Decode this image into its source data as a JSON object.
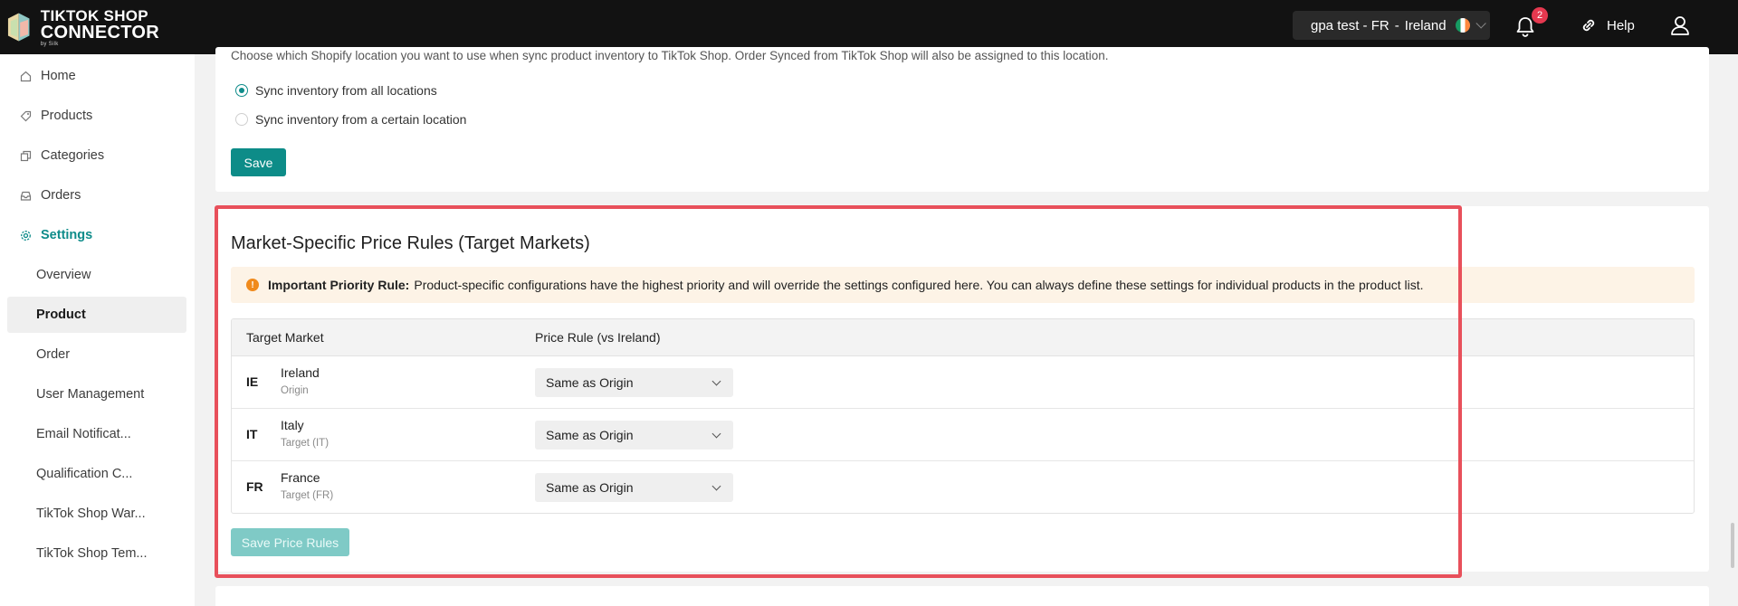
{
  "app": {
    "logo_line1": "TIKTOK SHOP",
    "logo_line2": "CONNECTOR",
    "logo_by": "by Silk"
  },
  "header": {
    "shop_name": "gpa test - FR",
    "shop_separator": "-",
    "shop_region": "Ireland",
    "notification_count": "2",
    "help_label": "Help"
  },
  "sidebar": {
    "items": [
      {
        "label": "Home",
        "icon": "home-icon"
      },
      {
        "label": "Products",
        "icon": "tag-icon"
      },
      {
        "label": "Categories",
        "icon": "copy-icon"
      },
      {
        "label": "Orders",
        "icon": "inbox-icon"
      },
      {
        "label": "Settings",
        "icon": "gear-icon"
      }
    ],
    "settings_sub": [
      {
        "label": "Overview"
      },
      {
        "label": "Product"
      },
      {
        "label": "Order"
      },
      {
        "label": "User Management"
      },
      {
        "label": "Email Notificat..."
      },
      {
        "label": "Qualification C..."
      },
      {
        "label": "TikTok Shop War..."
      },
      {
        "label": "TikTok Shop Tem..."
      }
    ]
  },
  "location_card": {
    "description": "Choose which Shopify location you want to use when sync product inventory to TikTok Shop. Order Synced from TikTok Shop will also be assigned to this location.",
    "options": [
      {
        "label": "Sync inventory from all locations",
        "selected": true
      },
      {
        "label": "Sync inventory from a certain location",
        "selected": false
      }
    ],
    "save_label": "Save"
  },
  "price_rules": {
    "title": "Market-Specific Price Rules (Target Markets)",
    "alert_strong": "Important Priority Rule:",
    "alert_text": "Product-specific configurations have the highest priority and will override the settings configured here. You can always define these settings for individual products in the product list.",
    "columns": [
      "Target Market",
      "Price Rule (vs Ireland)"
    ],
    "rows": [
      {
        "code": "IE",
        "name": "Ireland",
        "sub": "Origin",
        "rule": "Same as Origin"
      },
      {
        "code": "IT",
        "name": "Italy",
        "sub": "Target (IT)",
        "rule": "Same as Origin"
      },
      {
        "code": "FR",
        "name": "France",
        "sub": "Target (FR)",
        "rule": "Same as Origin"
      }
    ],
    "save_label": "Save Price Rules"
  },
  "colors": {
    "accent": "#0d8c88",
    "highlight": "#e8505b",
    "alert_bg": "#fdf3e6"
  }
}
